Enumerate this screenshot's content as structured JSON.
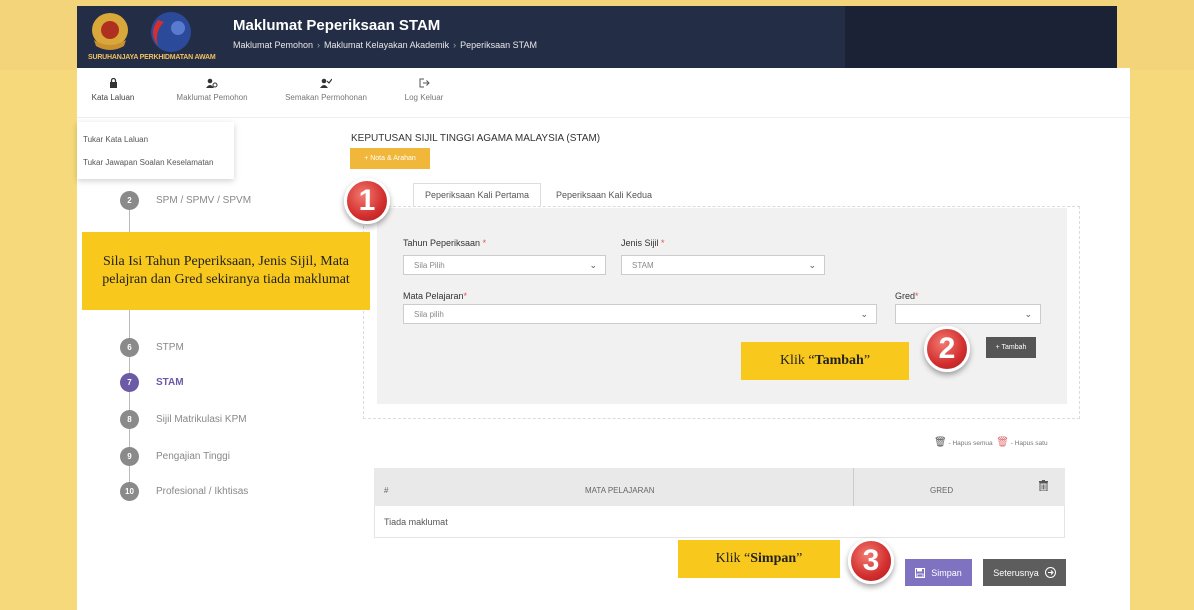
{
  "header": {
    "logo_text": "SURUHANJAYA PERKHIDMATAN AWAM",
    "title": "Maklumat Peperiksaan STAM",
    "breadcrumb": [
      "Maklumat Pemohon",
      "Maklumat Kelayakan Akademik",
      "Peperiksaan STAM"
    ]
  },
  "topnav": {
    "items": [
      {
        "label": "Kata Laluan",
        "icon": "lock-icon"
      },
      {
        "label": "Maklumat Pemohon",
        "icon": "users-icon"
      },
      {
        "label": "Semakan Permohonan",
        "icon": "user-check-icon"
      },
      {
        "label": "Log Keluar",
        "icon": "sign-out-icon"
      }
    ]
  },
  "dropdown": {
    "items": [
      "Tukar Kata Laluan",
      "Tukar Jawapan Soalan Keselamatan"
    ]
  },
  "steps": [
    {
      "num": "2",
      "label": "SPM / SPMV / SPVM"
    },
    {
      "num": "6",
      "label": "STPM"
    },
    {
      "num": "7",
      "label": "STAM",
      "active": true
    },
    {
      "num": "8",
      "label": "Sijil Matrikulasi KPM"
    },
    {
      "num": "9",
      "label": "Pengajian Tinggi"
    },
    {
      "num": "10",
      "label": "Profesional / Ikhtisas"
    }
  ],
  "main": {
    "title": "KEPUTUSAN SIJIL TINGGI AGAMA MALAYSIA (STAM)",
    "nota_button": "+ Nota & Arahan",
    "tabs": [
      "Peperiksaan Kali Pertama",
      "Peperiksaan Kali Kedua"
    ]
  },
  "form": {
    "tahun_label": "Tahun Peperiksaan",
    "tahun_value": "Sila Pilih",
    "jenis_label": "Jenis Sijil",
    "jenis_value": "STAM",
    "mata_label": "Mata Pelajaran",
    "mata_value": "Sila pilih",
    "gred_label": "Gred",
    "gred_value": "",
    "required_mark": "*",
    "tambah_button": "+ Tambah"
  },
  "table": {
    "hapus_semua": "- Hapus semua",
    "hapus_satu": "- Hapus satu",
    "headers": [
      "#",
      "MATA PELAJARAN",
      "GRED"
    ],
    "empty_text": "Tiada maklumat"
  },
  "actions": {
    "simpan": "Simpan",
    "seterusnya": "Seterusnya"
  },
  "callouts": {
    "instruction": "Sila Isi Tahun Peperiksaan, Jenis Sijil, Mata pelajran dan Gred sekiranya tiada maklumat",
    "tambah_prefix": "Klik “",
    "tambah_word": "Tambah",
    "tambah_suffix": "”",
    "simpan_prefix": "Klik “",
    "simpan_word": "Simpan",
    "simpan_suffix": "”"
  },
  "badges": [
    "1",
    "2",
    "3"
  ],
  "colors": {
    "header_bg": "#232d45",
    "accent_purple": "#6b5aa6",
    "callout_yellow": "#f9c81c",
    "badge_red": "#d22e2e",
    "page_bg": "#f6d97a"
  }
}
